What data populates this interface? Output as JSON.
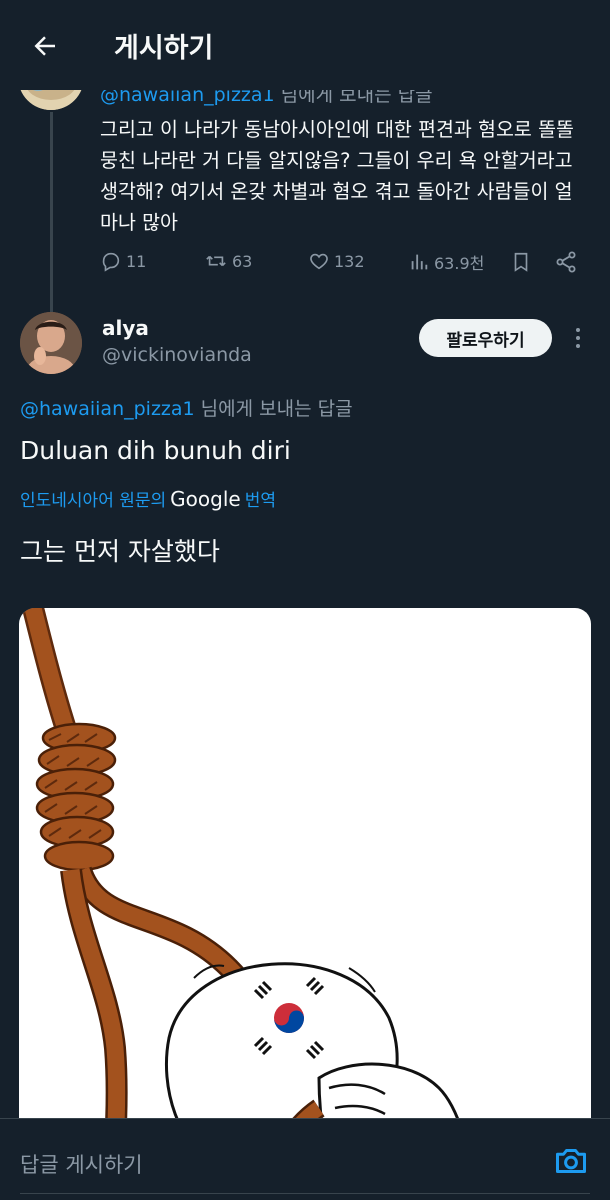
{
  "header": {
    "title": "게시하기"
  },
  "previous_post": {
    "replying_prefix": "@hawaiian_pizza1",
    "replying_suffix": " 님에게 보내는 답글",
    "text": "그리고 이 나라가 동남아시아인에 대한 편견과 혐오로 똘똘 뭉친 나라란 거 다들 알지않음? 그들이 우리 욕 안할거라고 생각해? 여기서 온갖 차별과 혐오 겪고 돌아간 사람들이 얼마나 많아",
    "stats": {
      "replies": "11",
      "reposts": "63",
      "likes": "132",
      "views": "63.9천"
    }
  },
  "post": {
    "name": "alya",
    "handle": "@vickinovianda",
    "follow_label": "팔로우하기",
    "replying_prefix": "@hawaiian_pizza1",
    "replying_suffix": " 님에게 보내는 답글",
    "text": "Duluan dih bunuh diri",
    "translation_prefix": "인도네시아어 원문의",
    "translation_brand": "Google",
    "translation_suffix": "번역",
    "translated_text": "그는 먼저 자살했다"
  },
  "composer": {
    "placeholder": "답글 게시하기"
  },
  "colors": {
    "background": "#15202b",
    "accent": "#1d9bf0",
    "muted": "#8b98a5",
    "rope": "#a3521e"
  }
}
